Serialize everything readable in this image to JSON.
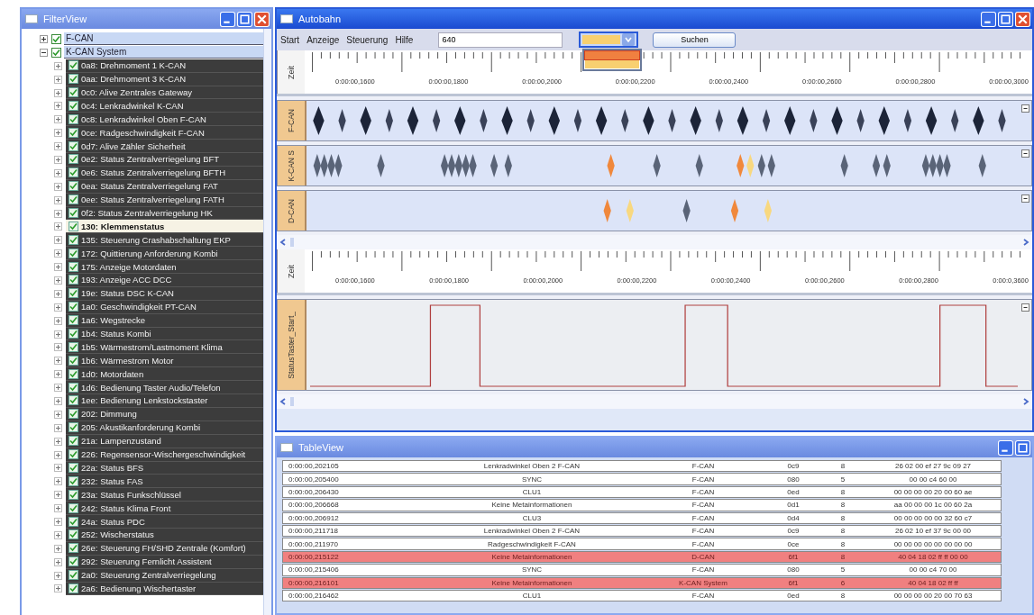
{
  "filter_view": {
    "title": "FilterView",
    "tree": [
      {
        "label": "F-CAN",
        "checked": true,
        "expanded": false,
        "selected": false
      },
      {
        "label": "K-CAN System",
        "checked": true,
        "expanded": true,
        "selected": false,
        "children": [
          {
            "label": "0a8: Drehmoment 1 K-CAN",
            "checked": true,
            "expanded": false,
            "selected": false
          },
          {
            "label": "0aa: Drehmoment 3 K-CAN",
            "checked": true,
            "expanded": false,
            "selected": false
          },
          {
            "label": "0c0: Alive Zentrales Gateway",
            "checked": true,
            "expanded": false,
            "selected": false
          },
          {
            "label": "0c4: Lenkradwinkel K-CAN",
            "checked": true,
            "expanded": false,
            "selected": false
          },
          {
            "label": "0c8: Lenkradwinkel Oben F-CAN",
            "checked": true,
            "expanded": false,
            "selected": false
          },
          {
            "label": "0ce: Radgeschwindigkeit F-CAN",
            "checked": true,
            "expanded": false,
            "selected": false
          },
          {
            "label": "0d7: Alive Zähler Sicherheit",
            "checked": true,
            "expanded": false,
            "selected": false
          },
          {
            "label": "0e2: Status Zentralverriegelung BFT",
            "checked": true,
            "expanded": false,
            "selected": false
          },
          {
            "label": "0e6: Status Zentralverriegelung BFTH",
            "checked": true,
            "expanded": false,
            "selected": false
          },
          {
            "label": "0ea: Status Zentralverriegelung FAT",
            "checked": true,
            "expanded": false,
            "selected": false
          },
          {
            "label": "0ee: Status Zentralverriegelung FATH",
            "checked": true,
            "expanded": false,
            "selected": false
          },
          {
            "label": "0f2: Status Zentralverriegelung HK",
            "checked": true,
            "expanded": false,
            "selected": false
          },
          {
            "label": "130: Klemmenstatus",
            "checked": true,
            "expanded": false,
            "selected": true
          },
          {
            "label": "135: Steuerung Crashabschaltung EKP",
            "checked": true,
            "expanded": false,
            "selected": false
          },
          {
            "label": "172: Quittierung Anforderung Kombi",
            "checked": true,
            "expanded": false,
            "selected": false
          },
          {
            "label": "175: Anzeige Motordaten",
            "checked": true,
            "expanded": false,
            "selected": false
          },
          {
            "label": "193: Anzeige ACC DCC",
            "checked": true,
            "expanded": false,
            "selected": false
          },
          {
            "label": "19e: Status DSC K-CAN",
            "checked": true,
            "expanded": false,
            "selected": false
          },
          {
            "label": "1a0: Geschwindigkeit PT-CAN",
            "checked": true,
            "expanded": false,
            "selected": false
          },
          {
            "label": "1a6: Wegstrecke",
            "checked": true,
            "expanded": false,
            "selected": false
          },
          {
            "label": "1b4: Status Kombi",
            "checked": true,
            "expanded": false,
            "selected": false
          },
          {
            "label": "1b5: Wärmestrom/Lastmoment Klima",
            "checked": true,
            "expanded": false,
            "selected": false
          },
          {
            "label": "1b6: Wärmestrom Motor",
            "checked": true,
            "expanded": false,
            "selected": false
          },
          {
            "label": "1d0: Motordaten",
            "checked": true,
            "expanded": false,
            "selected": false
          },
          {
            "label": "1d6: Bedienung Taster Audio/Telefon",
            "checked": true,
            "expanded": false,
            "selected": false
          },
          {
            "label": "1ee: Bedienung Lenkstockstaster",
            "checked": true,
            "expanded": false,
            "selected": false
          },
          {
            "label": "202: Dimmung",
            "checked": true,
            "expanded": false,
            "selected": false
          },
          {
            "label": "205: Akustikanforderung Kombi",
            "checked": true,
            "expanded": false,
            "selected": false
          },
          {
            "label": "21a: Lampenzustand",
            "checked": true,
            "expanded": false,
            "selected": false
          },
          {
            "label": "226: Regensensor-Wischergeschwindigkeit",
            "checked": true,
            "expanded": false,
            "selected": false
          },
          {
            "label": "22a: Status BFS",
            "checked": true,
            "expanded": false,
            "selected": false
          },
          {
            "label": "232: Status FAS",
            "checked": true,
            "expanded": false,
            "selected": false
          },
          {
            "label": "23a: Status Funkschlüssel",
            "checked": true,
            "expanded": false,
            "selected": false
          },
          {
            "label": "242: Status Klima Front",
            "checked": true,
            "expanded": false,
            "selected": false
          },
          {
            "label": "24a: Status PDC",
            "checked": true,
            "expanded": false,
            "selected": false
          },
          {
            "label": "252: Wischerstatus",
            "checked": true,
            "expanded": false,
            "selected": false
          },
          {
            "label": "26e: Steuerung FH/SHD Zentrale (Komfort)",
            "checked": true,
            "expanded": false,
            "selected": false
          },
          {
            "label": "292: Steuerung Fernlicht Assistent",
            "checked": true,
            "expanded": false,
            "selected": false
          },
          {
            "label": "2a0: Steuerung Zentralverriegelung",
            "checked": true,
            "expanded": false,
            "selected": false
          },
          {
            "label": "2a6: Bedienung Wischertaster",
            "checked": true,
            "expanded": false,
            "selected": false
          }
        ]
      }
    ]
  },
  "autobahn": {
    "title": "Autobahn",
    "menu": [
      "Start",
      "Anzeige",
      "Steuerung",
      "Hilfe"
    ],
    "search_field": {
      "value": "640"
    },
    "color_dropdown": {
      "color": "#f8d070",
      "expanded": true,
      "options": [
        {
          "color": "#f08040",
          "selected": true
        },
        {
          "color": "#f8d070",
          "selected": false
        }
      ]
    },
    "search_button": "Suchen",
    "views": [
      {
        "ruler": {
          "label": "Zeit",
          "ticks": [
            "0:00:00,1600",
            "0:00:00,1800",
            "0:00:00,2000",
            "0:00:00,2200",
            "0:00:00,2400",
            "0:00:00,2600",
            "0:00:00,2800",
            "0:00:00,3000"
          ]
        },
        "lanes": [
          {
            "label": "F-CAN",
            "kind": "events"
          },
          {
            "label": "K-CAN S",
            "kind": "events"
          },
          {
            "label": "D-CAN",
            "kind": "events"
          }
        ]
      },
      {
        "ruler": {
          "label": "Zeit",
          "ticks": [
            "0:00:00,1600",
            "0:00:00,1800",
            "0:00:00,2000",
            "0:00:00,2200",
            "0:00:00,2400",
            "0:00:00,2600",
            "0:00:00,2800",
            "0:00:0,3600"
          ]
        },
        "lanes": [
          {
            "label": "StatusTaster_Start_",
            "kind": "signal"
          }
        ]
      }
    ]
  },
  "table_view": {
    "title": "TableView",
    "rows": [
      {
        "highlighted": false,
        "cells": [
          "0:00:00,202105",
          "Lenkradwinkel Oben 2 F-CAN",
          "F-CAN",
          "0c9",
          "8",
          "26 02 00 ef 27 9c 09 27"
        ]
      },
      {
        "highlighted": false,
        "cells": [
          "0:00:00,205400",
          "SYNC",
          "F-CAN",
          "080",
          "5",
          "00 00 c4 60 00"
        ]
      },
      {
        "highlighted": false,
        "cells": [
          "0:00:00,206430",
          "CLU1",
          "F-CAN",
          "0ed",
          "8",
          "00 00 00 00 20 00 60 ae"
        ]
      },
      {
        "highlighted": false,
        "cells": [
          "0:00:00,206668",
          "Keine Metainformationen",
          "F-CAN",
          "0d1",
          "8",
          "aa 00 00 00 1c 00 60 2a"
        ]
      },
      {
        "highlighted": false,
        "cells": [
          "0:00:00,206912",
          "CLU3",
          "F-CAN",
          "0d4",
          "8",
          "00 00 00 00 00 32 60 c7"
        ]
      },
      {
        "highlighted": false,
        "cells": [
          "0:00:00,211718",
          "Lenkradwinkel Oben 2 F-CAN",
          "F-CAN",
          "0c9",
          "8",
          "26 02 10 ef 37 9c 00 00"
        ]
      },
      {
        "highlighted": false,
        "cells": [
          "0:00:00,211970",
          "Radgeschwindigkeit F-CAN",
          "F-CAN",
          "0ce",
          "8",
          "00 00 00 00 00 00 00 00"
        ]
      },
      {
        "highlighted": true,
        "cells": [
          "0:00:00,215122",
          "Keine Metainformationen",
          "D-CAN",
          "6f1",
          "8",
          "40 04 18 02 ff ff 00 00"
        ]
      },
      {
        "highlighted": false,
        "cells": [
          "0:00:00,215406",
          "SYNC",
          "F-CAN",
          "080",
          "5",
          "00 00 c4 70 00"
        ]
      },
      {
        "highlighted": true,
        "cells": [
          "0:00:00,216101",
          "Keine Metainformationen",
          "K-CAN System",
          "6f1",
          "6",
          "40 04 18 02 ff ff"
        ]
      },
      {
        "highlighted": false,
        "cells": [
          "0:00:00,216462",
          "CLU1",
          "F-CAN",
          "0ed",
          "8",
          "00 00 00 00 20 00 70 63"
        ]
      }
    ]
  }
}
